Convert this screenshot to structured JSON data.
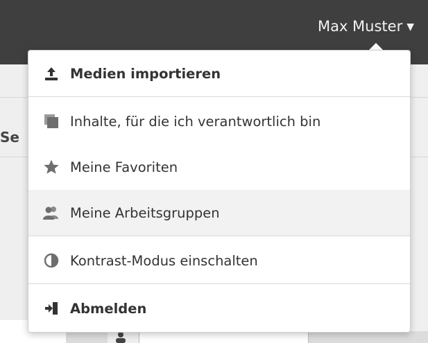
{
  "header": {
    "user_name": "Max Muster",
    "caret": "▼"
  },
  "background": {
    "partial_label": "Se"
  },
  "menu": {
    "items": [
      {
        "label": "Medien importieren",
        "icon": "upload-icon",
        "bold": true
      },
      {
        "label": "Inhalte, für die ich verantwortlich bin",
        "icon": "content-stack-icon",
        "bold": false
      },
      {
        "label": "Meine Favoriten",
        "icon": "star-icon",
        "bold": false
      },
      {
        "label": "Meine Arbeitsgruppen",
        "icon": "group-icon",
        "bold": false,
        "hovered": true
      },
      {
        "label": "Kontrast-Modus einschalten",
        "icon": "contrast-icon",
        "bold": false
      },
      {
        "label": "Abmelden",
        "icon": "logout-icon",
        "bold": true
      }
    ]
  },
  "colors": {
    "topbar": "#3f3f3f",
    "menu_text": "#333333",
    "icon": "#6e6e6e",
    "hover_bg": "#f2f2f2"
  }
}
